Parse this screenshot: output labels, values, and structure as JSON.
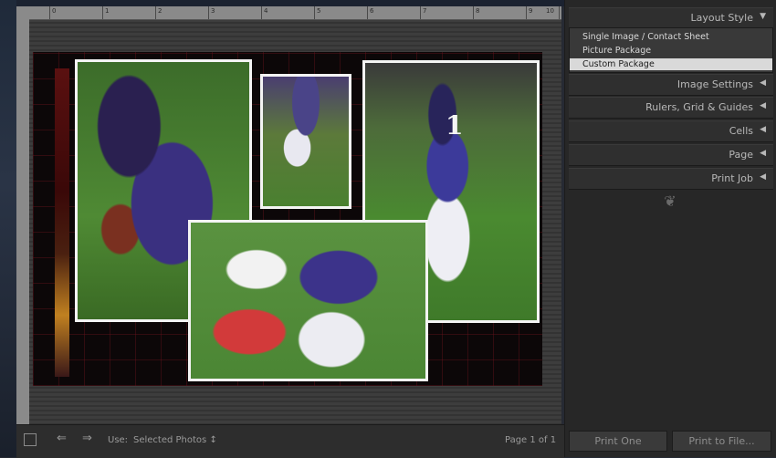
{
  "canvas": {
    "ruler_numbers": [
      "0",
      "1",
      "2",
      "3",
      "4",
      "5",
      "6",
      "7",
      "8",
      "9",
      "10"
    ],
    "photo_jersey_number": "1"
  },
  "toolbar": {
    "use_label": "Use:",
    "selected_photos_label": "Selected Photos ↕",
    "page_label": "Page 1 of 1"
  },
  "panel": {
    "layout_style": {
      "title": "Layout Style",
      "options": [
        {
          "label": "Single Image / Contact Sheet",
          "selected": false
        },
        {
          "label": "Picture Package",
          "selected": false
        },
        {
          "label": "Custom Package",
          "selected": true
        }
      ]
    },
    "sections": [
      {
        "label": "Image Settings"
      },
      {
        "label": "Rulers, Grid & Guides"
      },
      {
        "label": "Cells"
      },
      {
        "label": "Page"
      },
      {
        "label": "Print Job"
      }
    ],
    "buttons": {
      "print_one": "Print One",
      "print_to_file": "Print to File..."
    }
  }
}
